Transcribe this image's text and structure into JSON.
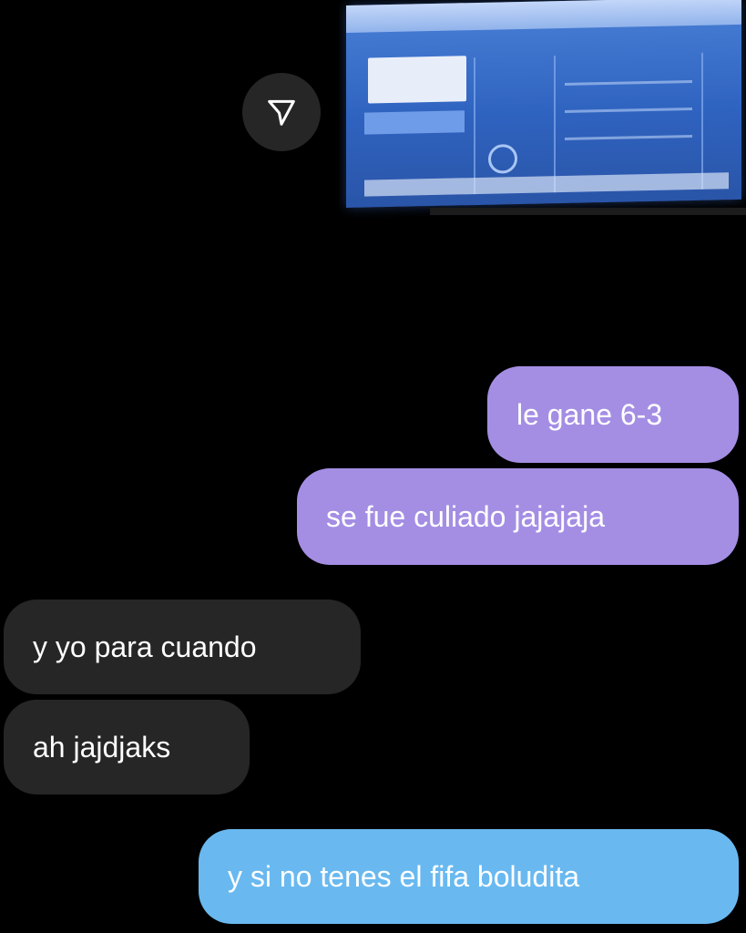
{
  "shared_media": {
    "share_icon": "send-icon"
  },
  "messages": [
    {
      "text": "le gane 6-3",
      "direction": "sent"
    },
    {
      "text": "se fue culiado jajajaja",
      "direction": "sent"
    },
    {
      "text": "y yo para cuando",
      "direction": "received"
    },
    {
      "text": "ah jajdjaks",
      "direction": "received"
    },
    {
      "text": "y si no tenes el fifa boludita",
      "direction": "sent"
    }
  ],
  "colors": {
    "background": "#000000",
    "sent_bubble": "#a48ee4",
    "received_bubble": "#262626",
    "last_sent_bubble": "#69b9f0"
  }
}
